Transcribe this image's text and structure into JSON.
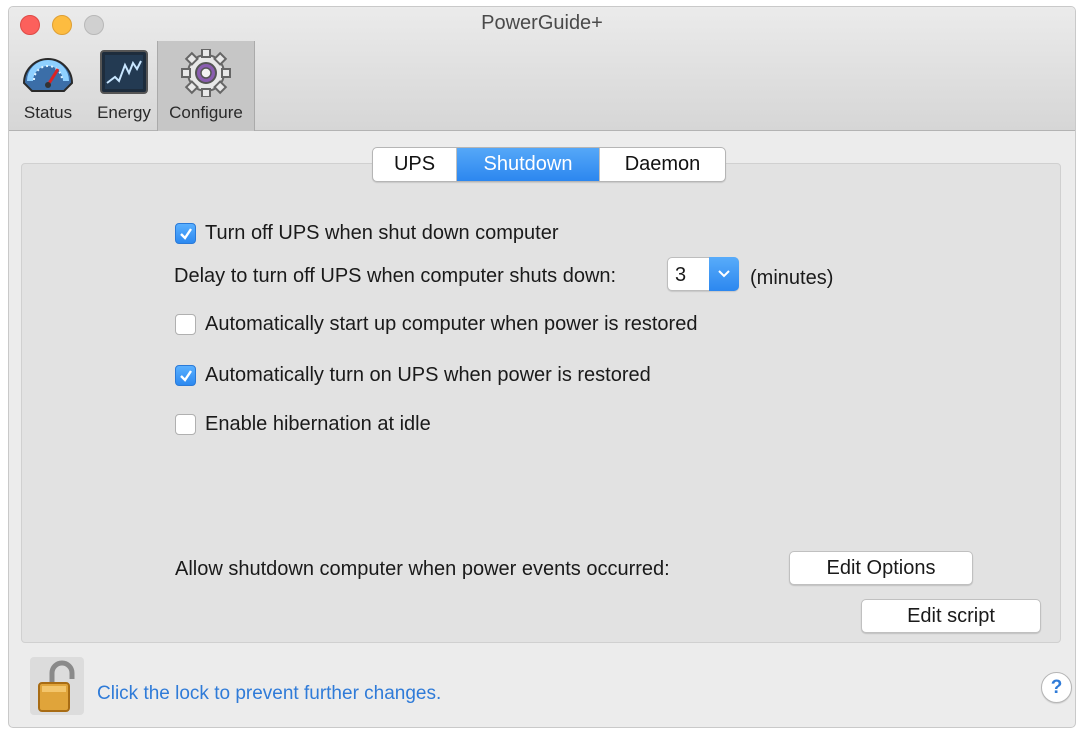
{
  "window": {
    "title": "PowerGuide+"
  },
  "toolbar": {
    "items": [
      {
        "label": "Status",
        "icon": "gauge-icon"
      },
      {
        "label": "Energy",
        "icon": "energy-graph-icon"
      },
      {
        "label": "Configure",
        "icon": "gear-icon",
        "selected": true
      }
    ]
  },
  "tabs": [
    {
      "label": "UPS"
    },
    {
      "label": "Shutdown",
      "selected": true
    },
    {
      "label": "Daemon"
    }
  ],
  "settings": {
    "turn_off_ups": {
      "label": "Turn off UPS when shut down computer",
      "checked": true
    },
    "delay": {
      "label": "Delay to turn off UPS when computer shuts down:",
      "value": "3",
      "unit": "(minutes)"
    },
    "auto_startup": {
      "label": "Automatically start up computer when power is restored",
      "checked": false
    },
    "auto_turn_on": {
      "label": "Automatically turn on UPS when power is restored",
      "checked": true
    },
    "hibernation": {
      "label": "Enable hibernation at idle",
      "checked": false
    }
  },
  "shutdown_events": {
    "label": "Allow shutdown computer when power events occurred:",
    "edit_options": "Edit Options",
    "edit_script": "Edit script"
  },
  "footer": {
    "lock_text": "Click the lock to prevent further changes.",
    "help": "?"
  },
  "colors": {
    "accent": "#2c87ef",
    "link": "#2f7bd8"
  }
}
